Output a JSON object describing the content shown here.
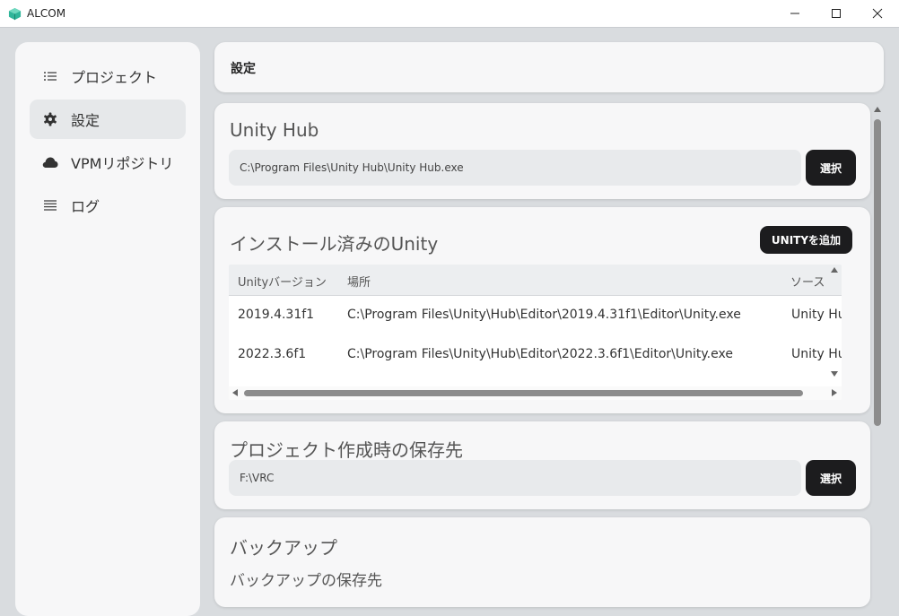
{
  "window": {
    "title": "ALCOM",
    "controls": {
      "minimize": "minimize-icon",
      "maximize": "maximize-icon",
      "close": "close-icon"
    }
  },
  "sidebar": {
    "items": [
      {
        "label": "プロジェクト",
        "icon": "list-icon",
        "active": false
      },
      {
        "label": "設定",
        "icon": "gear-icon",
        "active": true
      },
      {
        "label": "VPMリポジトリ",
        "icon": "cloud-icon",
        "active": false
      },
      {
        "label": "ログ",
        "icon": "lines-icon",
        "active": false
      }
    ]
  },
  "header": {
    "title": "設定"
  },
  "unity_hub": {
    "title": "Unity Hub",
    "path": "C:\\Program Files\\Unity Hub\\Unity Hub.exe",
    "select_label": "選択"
  },
  "installed_unity": {
    "title": "インストール済みのUnity",
    "add_label": "UNITYを追加",
    "columns": [
      "Unityバージョン",
      "場所",
      "ソース"
    ],
    "rows": [
      {
        "version": "2019.4.31f1",
        "location": "C:\\Program Files\\Unity\\Hub\\Editor\\2019.4.31f1\\Editor\\Unity.exe",
        "source": "Unity Hub"
      },
      {
        "version": "2022.3.6f1",
        "location": "C:\\Program Files\\Unity\\Hub\\Editor\\2022.3.6f1\\Editor\\Unity.exe",
        "source": "Unity Hub"
      }
    ]
  },
  "project_path": {
    "title": "プロジェクト作成時の保存先",
    "path": "F:\\VRC",
    "select_label": "選択"
  },
  "backup": {
    "title": "バックアップ",
    "subtitle": "バックアップの保存先"
  }
}
